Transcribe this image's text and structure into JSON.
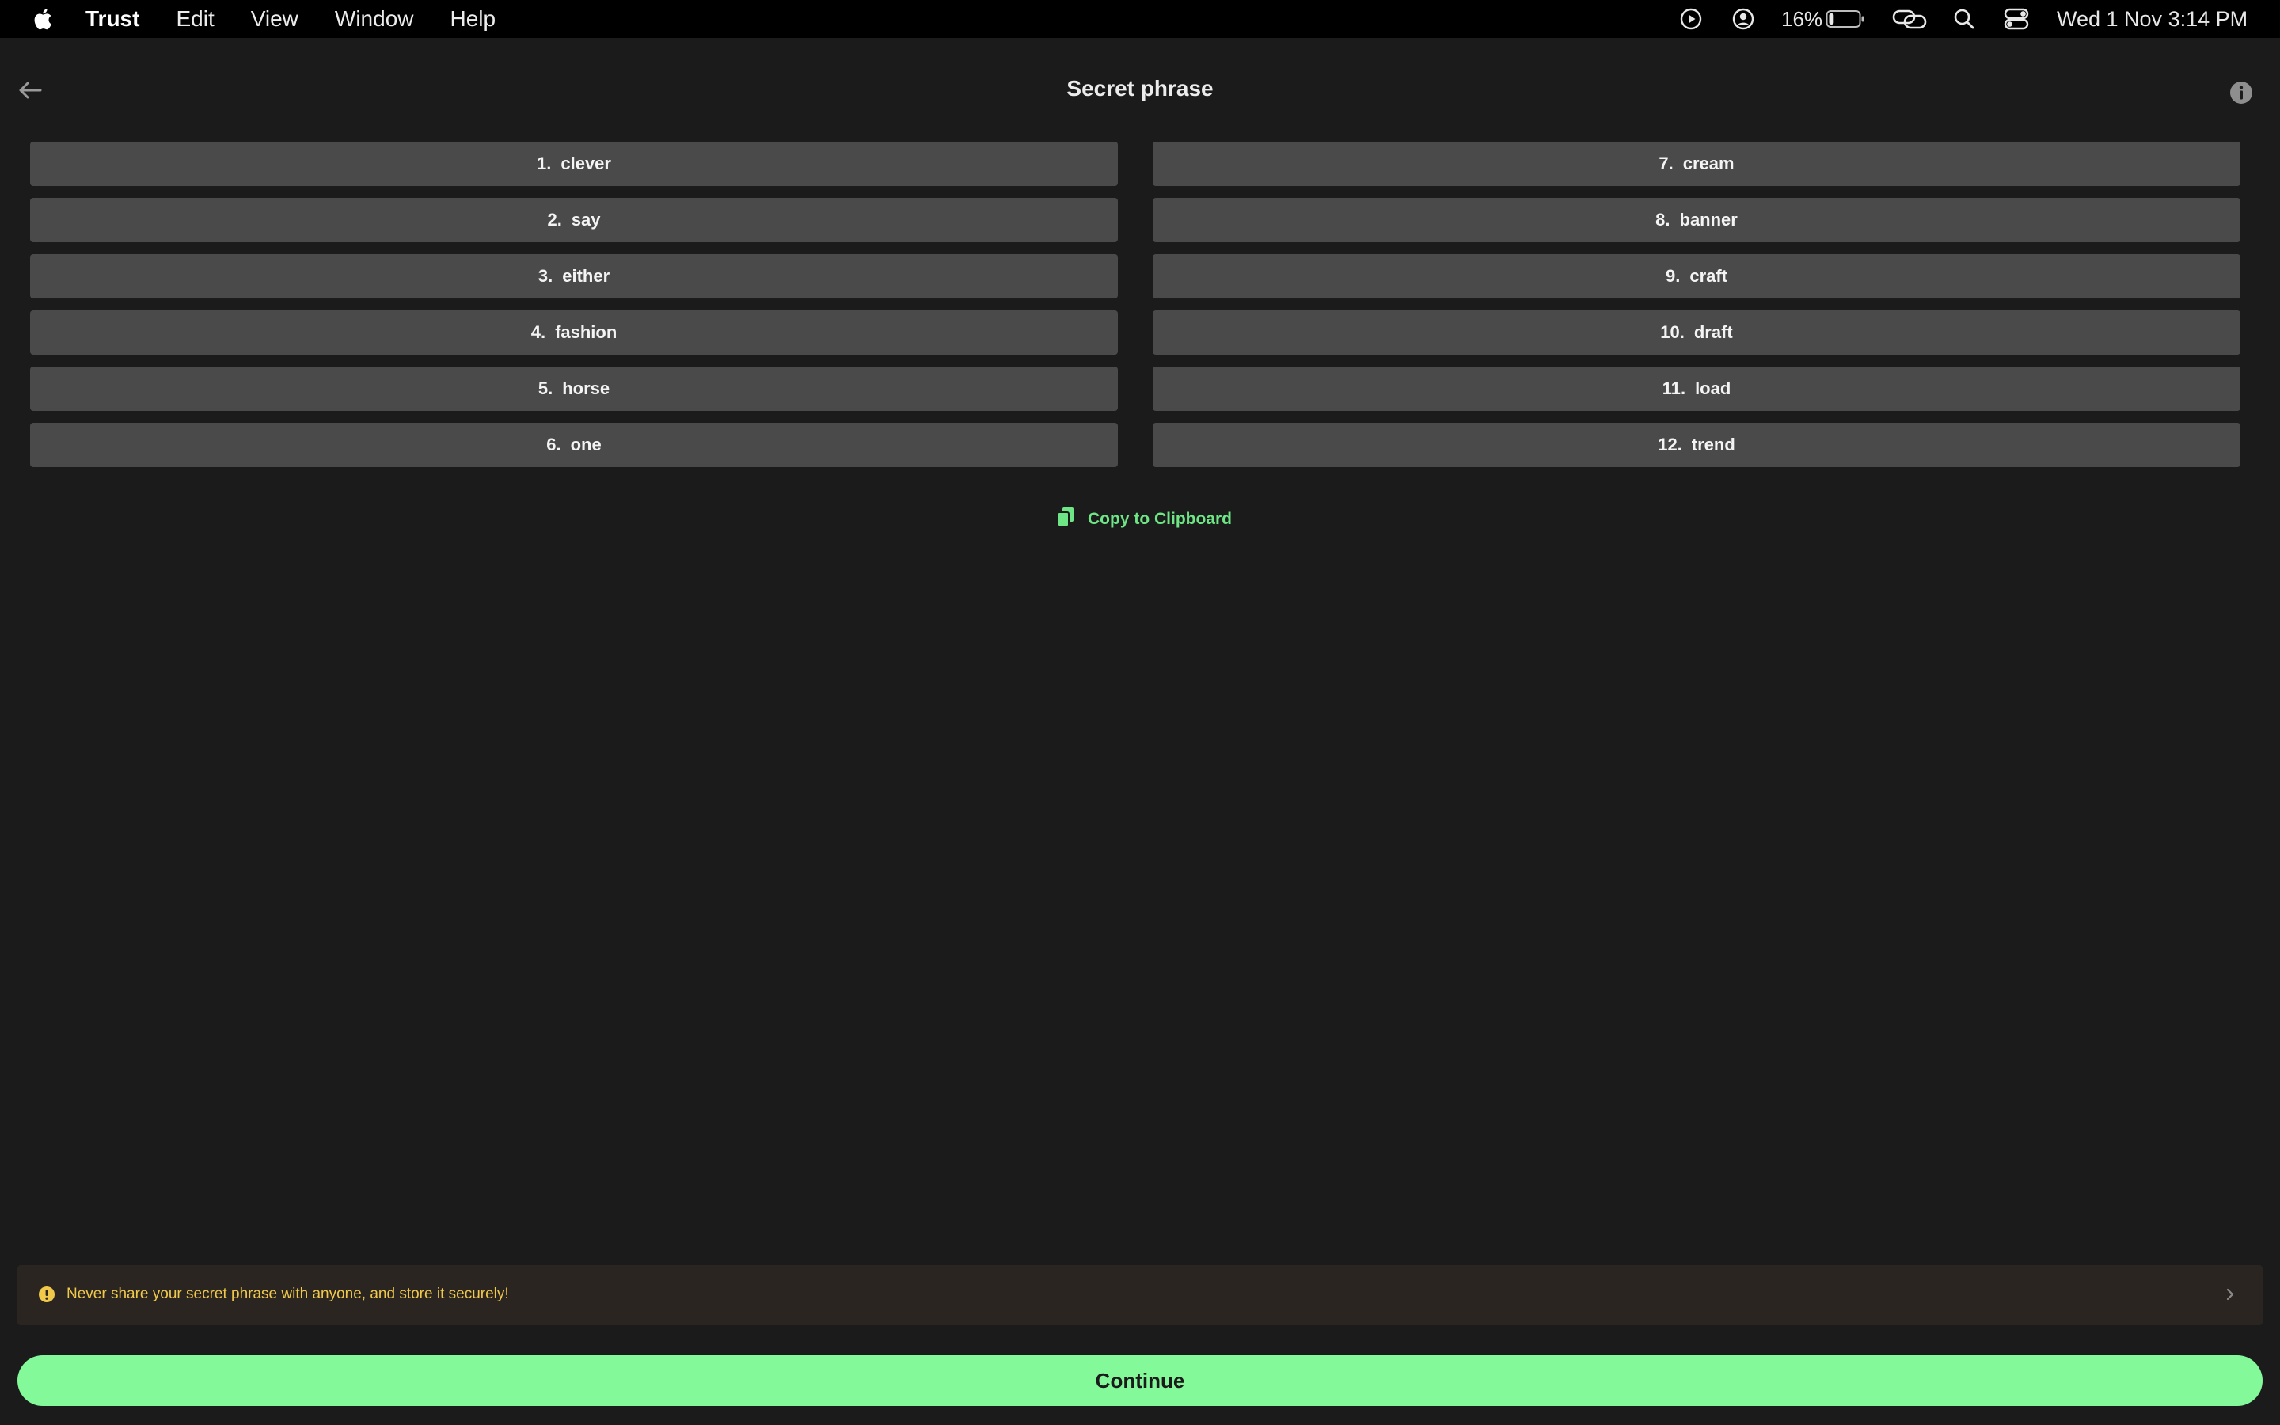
{
  "menubar": {
    "app_name": "Trust",
    "items": [
      "Edit",
      "View",
      "Window",
      "Help"
    ],
    "battery_percent": "16%",
    "battery_level": 0.16,
    "datetime": "Wed 1 Nov  3:14 PM",
    "icons": [
      "apple-logo",
      "play-circle-icon",
      "user-circle-icon",
      "battery-icon",
      "link-icon",
      "search-icon",
      "control-center-icon"
    ]
  },
  "header": {
    "title": "Secret phrase",
    "back_icon": "arrow-left-icon",
    "info_icon": "info-icon"
  },
  "phrase": {
    "words": [
      {
        "num": "1.",
        "word": "clever"
      },
      {
        "num": "2.",
        "word": "say"
      },
      {
        "num": "3.",
        "word": "either"
      },
      {
        "num": "4.",
        "word": "fashion"
      },
      {
        "num": "5.",
        "word": "horse"
      },
      {
        "num": "6.",
        "word": "one"
      },
      {
        "num": "7.",
        "word": "cream"
      },
      {
        "num": "8.",
        "word": "banner"
      },
      {
        "num": "9.",
        "word": "craft"
      },
      {
        "num": "10.",
        "word": "draft"
      },
      {
        "num": "11.",
        "word": "load"
      },
      {
        "num": "12.",
        "word": "trend"
      }
    ]
  },
  "copy": {
    "label": "Copy to Clipboard",
    "icon": "copy-icon"
  },
  "warning": {
    "text": "Never share your secret phrase with anyone, and store it securely!",
    "icon": "exclamation-icon"
  },
  "footer": {
    "continue_label": "Continue"
  },
  "colors": {
    "background": "#1b1b1b",
    "word_tile": "#4a4a4a",
    "accent_green": "#84f99a",
    "link_green": "#6ee686",
    "warning_bg": "#2a2520",
    "warning_text": "#f0c84a"
  }
}
